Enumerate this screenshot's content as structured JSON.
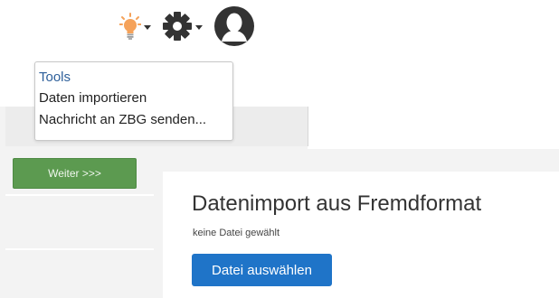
{
  "toolbar": {
    "icons": [
      "lightbulb-icon",
      "gear-icon",
      "user-avatar-icon"
    ],
    "bulb_color": "#f5a25a",
    "icon_color": "#333333"
  },
  "menu": {
    "header": "Tools",
    "items": [
      {
        "label": "Daten importieren"
      },
      {
        "label": "Nachricht an ZBG senden..."
      }
    ]
  },
  "wizard": {
    "next_label": "Weiter >>>",
    "next_color": "#5c9a50"
  },
  "import": {
    "title": "Datenimport aus Fremdformat",
    "status": "keine Datei gewählt",
    "choose_file_label": "Datei auswählen",
    "button_color": "#1f74c8"
  }
}
